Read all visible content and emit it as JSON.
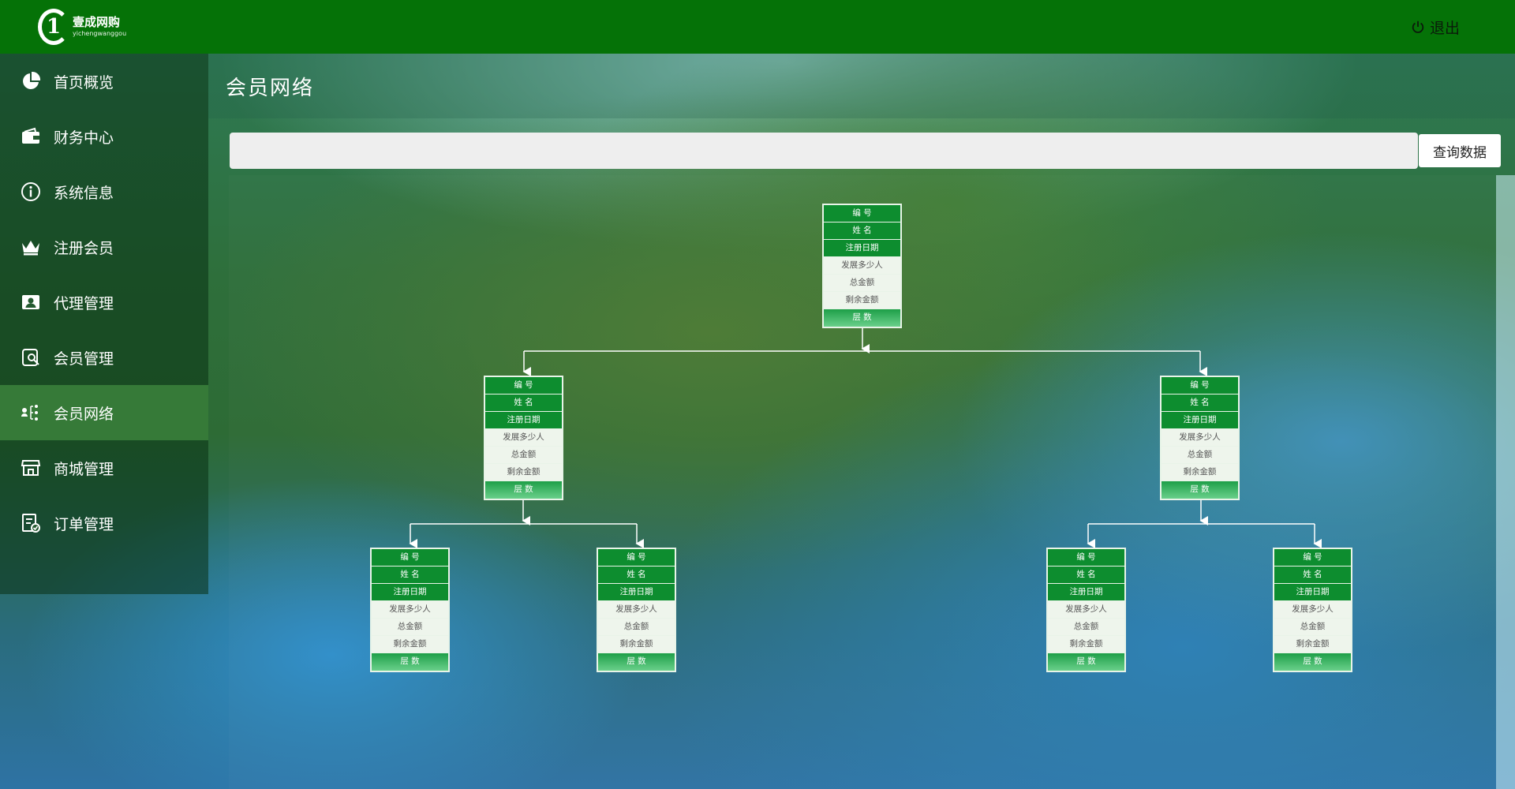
{
  "header": {
    "logo_mark": "1",
    "logo_cn": "壹成网购",
    "logo_pinyin": "yichengwanggou",
    "logout_label": "退出"
  },
  "sidebar": {
    "items": [
      {
        "label": "首页概览",
        "icon": "pie-chart-icon",
        "active": false
      },
      {
        "label": "财务中心",
        "icon": "wallet-icon",
        "active": false
      },
      {
        "label": "系统信息",
        "icon": "info-icon",
        "active": false
      },
      {
        "label": "注册会员",
        "icon": "crown-icon",
        "active": false
      },
      {
        "label": "代理管理",
        "icon": "id-card-icon",
        "active": false
      },
      {
        "label": "会员管理",
        "icon": "member-search-icon",
        "active": false
      },
      {
        "label": "会员网络",
        "icon": "network-icon",
        "active": true
      },
      {
        "label": "商城管理",
        "icon": "store-icon",
        "active": false
      },
      {
        "label": "订单管理",
        "icon": "order-icon",
        "active": false
      }
    ]
  },
  "page": {
    "title": "会员网络"
  },
  "search": {
    "value": "",
    "placeholder": "",
    "button_label": "查询数据"
  },
  "node_fields": [
    "编 号",
    "姓 名",
    "注册日期",
    "发展多少人",
    "总金额",
    "剩余金额",
    "层 数"
  ],
  "tree": {
    "nodes": [
      {
        "id": "root",
        "level": 0
      },
      {
        "id": "left",
        "level": 1
      },
      {
        "id": "right",
        "level": 1
      },
      {
        "id": "left-left",
        "level": 2
      },
      {
        "id": "left-right",
        "level": 2
      },
      {
        "id": "right-left",
        "level": 2
      },
      {
        "id": "right-right",
        "level": 2
      }
    ]
  },
  "colors": {
    "header_bg": "#057207",
    "node_header": "#0d8d2f",
    "node_footer": "#1e9f48",
    "active_nav": "#3c823c"
  }
}
